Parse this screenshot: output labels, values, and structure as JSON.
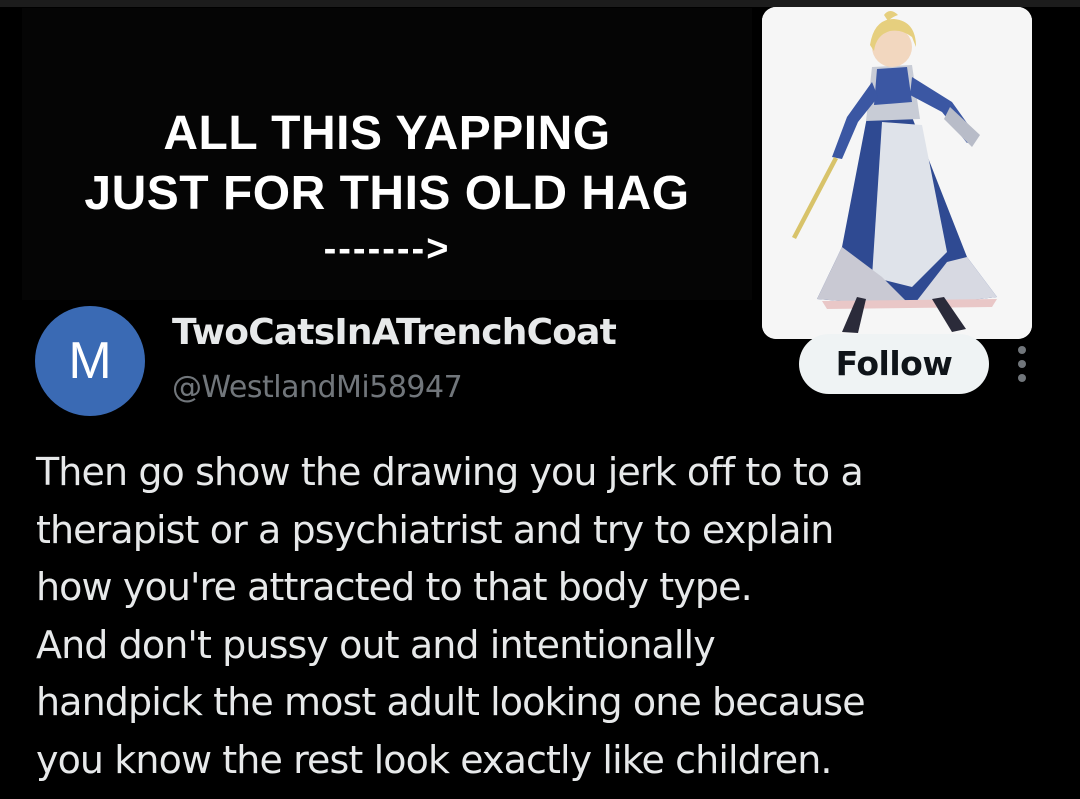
{
  "meme": {
    "caption_line_1": "ALL THIS YAPPING",
    "caption_line_2": "JUST FOR THIS OLD HAG",
    "caption_arrow": "------->"
  },
  "post": {
    "author": {
      "avatar_letter": "M",
      "avatar_color": "#3a6ab4",
      "display_name": "TwoCatsInATrenchCoat",
      "handle": "@WestlandMi58947"
    },
    "follow_label": "Follow",
    "more_icon": "more-options-icon",
    "text_lines": [
      "Then go show the drawing you jerk off to to a",
      "therapist or a psychiatrist and try to explain",
      "how you're attracted to that body type.",
      "And don't pussy out and intentionally",
      "handpick the most adult looking one because",
      "you know the rest look exactly like children."
    ]
  },
  "colors": {
    "background": "#000000",
    "primary_text": "#e7e9ea",
    "secondary_text": "#71767b",
    "follow_bg": "#eff3f4"
  }
}
